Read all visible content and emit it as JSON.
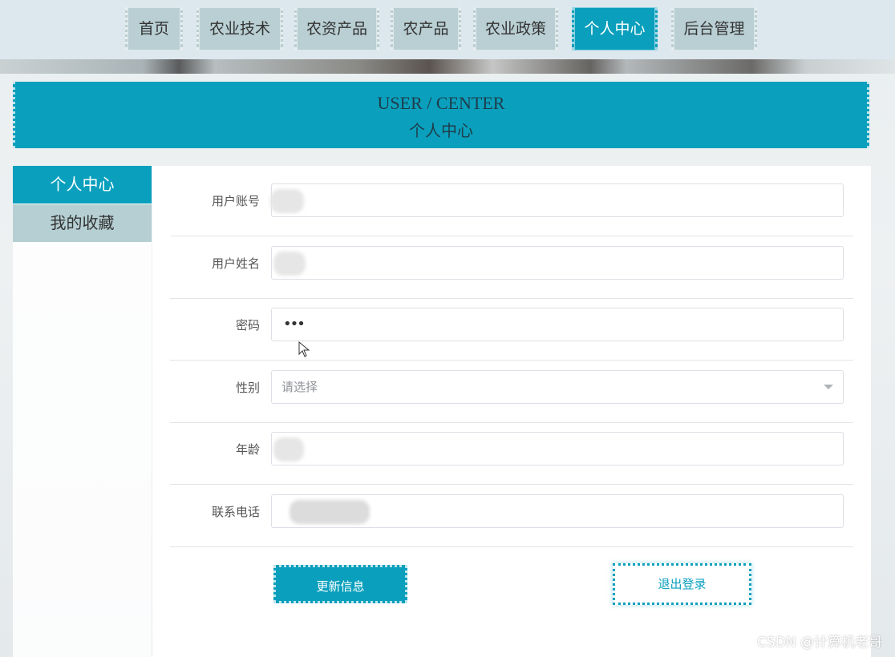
{
  "nav": {
    "items": [
      {
        "label": "首页"
      },
      {
        "label": "农业技术"
      },
      {
        "label": "农资产品"
      },
      {
        "label": "农产品"
      },
      {
        "label": "农业政策"
      },
      {
        "label": "个人中心"
      },
      {
        "label": "后台管理"
      }
    ],
    "active_index": 5
  },
  "header": {
    "title_en": "USER / CENTER",
    "title_zh": "个人中心"
  },
  "sidebar": {
    "items": [
      {
        "label": "个人中心"
      },
      {
        "label": "我的收藏"
      }
    ]
  },
  "form": {
    "account_label": "用户账号",
    "name_label": "用户姓名",
    "password_label": "密码",
    "password_value": "•••",
    "gender_label": "性别",
    "gender_placeholder": "请选择",
    "age_label": "年龄",
    "phone_label": "联系电话"
  },
  "buttons": {
    "update": "更新信息",
    "logout": "退出登录"
  },
  "watermark": "CSDN @计算机老哥",
  "colors": {
    "accent": "#0aa0bd",
    "nav_inactive": "#b9cfd3"
  }
}
